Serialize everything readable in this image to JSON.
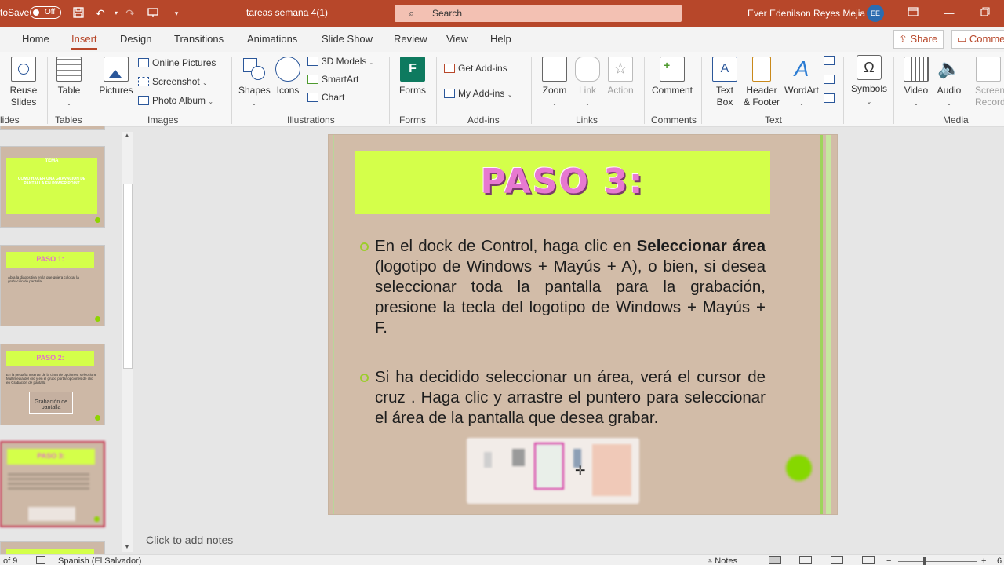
{
  "titlebar": {
    "autosave_label": "toSave",
    "autosave_state": "Off",
    "doc_title": "tareas semana 4(1)",
    "search_placeholder": "Search",
    "user_name": "Ever Edenilson Reyes Mejia",
    "user_initials": "EE"
  },
  "tabs": [
    "Home",
    "Insert",
    "Design",
    "Transitions",
    "Animations",
    "Slide Show",
    "Review",
    "View",
    "Help"
  ],
  "active_tab": "Insert",
  "share_label": "Share",
  "comments_label": "Comme",
  "ribbon": {
    "slides": {
      "reuse": "Reuse",
      "reuse2": "Slides",
      "group": "lides"
    },
    "tables": {
      "table": "Table",
      "group": "Tables"
    },
    "images": {
      "pictures": "Pictures",
      "online": "Online Pictures",
      "screenshot": "Screenshot",
      "album": "Photo Album",
      "group": "Images"
    },
    "illustrations": {
      "shapes": "Shapes",
      "icons": "Icons",
      "models": "3D Models",
      "smartart": "SmartArt",
      "chart": "Chart",
      "group": "Illustrations"
    },
    "forms": {
      "forms": "Forms",
      "group": "Forms"
    },
    "addins": {
      "get": "Get Add-ins",
      "my": "My Add-ins",
      "group": "Add-ins"
    },
    "links": {
      "zoom": "Zoom",
      "link": "Link",
      "action": "Action",
      "group": "Links"
    },
    "comments": {
      "comment": "Comment",
      "group": "Comments"
    },
    "text": {
      "textbox": "Text",
      "textbox2": "Box",
      "header": "Header",
      "header2": "& Footer",
      "wordart": "WordArt",
      "group": "Text"
    },
    "symbols": {
      "symbols": "Symbols"
    },
    "media": {
      "video": "Video",
      "audio": "Audio",
      "screen": "Screen",
      "screen2": "Recordin",
      "group": "Media"
    }
  },
  "thumbnails": [
    {
      "title": "TEMA",
      "text": "COMO HACER UNA GRAVACION DE PANTALLA EN POWER POINT"
    },
    {
      "title": "PASO 1:",
      "text": "Abra la diapositiva en la que quiera colocar la grabación de pantalla."
    },
    {
      "title": "PASO 2:",
      "text": "En la pestaña Insertar de la cinta de opciones, seleccione Multimedia del clic y en el grupo portar opciones de clic en Grabación de pantalla",
      "inner": "Grabación de pantalla"
    },
    {
      "title": "PASO 3:",
      "text": ""
    }
  ],
  "slide": {
    "title": "PASO 3:",
    "bullet1_a": "En el dock de Control, haga clic en ",
    "bullet1_b": "Seleccionar área",
    "bullet1_c": " (logotipo de Windows + Mayús + A), o bien, si desea seleccionar toda la pantalla para la grabación, presione la tecla del logotipo de Windows + Mayús + F.",
    "bullet2": "Si ha decidido seleccionar un área, verá el cursor de cruz    . Haga clic y arrastre el puntero para seleccionar el área de la pantalla que desea grabar."
  },
  "notes_placeholder": "Click to add notes",
  "statusbar": {
    "slide_count": "of 9",
    "language": "Spanish (El Salvador)",
    "notes_label": "Notes",
    "zoom": "6"
  },
  "colors": {
    "accent": "#b7472a",
    "slide_bg": "#d2bca8",
    "title_band": "#d4ff4a",
    "title_text": "#e779d0",
    "bullet": "#9ccd2d"
  }
}
